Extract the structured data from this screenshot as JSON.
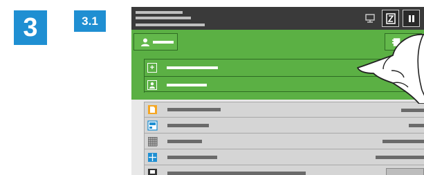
{
  "steps": {
    "main": "3",
    "sub": "3.1"
  },
  "toolbar": {
    "device_icon": "device-monitor-icon",
    "collate_icon": "collate-icon",
    "pause_icon": "pause-icon"
  },
  "header": {
    "left_button_icon": "user-icon",
    "right_button_icon": "address-book-icon"
  },
  "green_list": {
    "items": [
      {
        "icon": "add-icon",
        "glyph": "+"
      },
      {
        "icon": "user-icon",
        "glyph": ""
      }
    ]
  },
  "settings_list": {
    "rows": [
      {
        "icon": "color-mode-icon"
      },
      {
        "icon": "resolution-icon"
      },
      {
        "icon": "grid-icon"
      },
      {
        "icon": "layout-icon"
      },
      {
        "icon": "sides-icon"
      }
    ]
  },
  "colors": {
    "accent_blue": "#1f8fd2",
    "green": "#5bb044",
    "topbar": "#3a3a3a",
    "orange": "#f5a623"
  }
}
